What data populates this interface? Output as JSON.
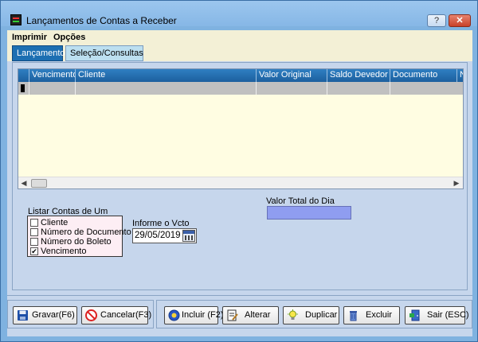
{
  "window": {
    "title": "Lançamentos de Contas a Receber",
    "help_label": "?",
    "close_label": "✕"
  },
  "menu": {
    "items": [
      {
        "label": "Imprimir"
      },
      {
        "label": "Opções"
      }
    ]
  },
  "tabs": [
    {
      "label": "Lançamentos",
      "active": true
    },
    {
      "label": "Seleção/Consultas",
      "active": false
    }
  ],
  "grid": {
    "columns": [
      "Vencimento",
      "Cliente",
      "Valor Original",
      "Saldo Devedor",
      "Documento",
      "Nº"
    ],
    "rows": [
      {
        "vencimento": "",
        "cliente": "",
        "valor_original": "",
        "saldo_devedor": "",
        "documento": ""
      }
    ]
  },
  "scrollbar": {
    "left_arrow": "◀",
    "right_arrow": "▶"
  },
  "total": {
    "label": "Valor Total do Dia",
    "value": ""
  },
  "list_filter": {
    "label": "Listar Contas de Um",
    "options": [
      {
        "label": "Cliente",
        "checked": false
      },
      {
        "label": "Número de Documento",
        "checked": false
      },
      {
        "label": "Número do Boleto",
        "checked": false
      },
      {
        "label": "Vencimento",
        "checked": true
      }
    ]
  },
  "vcto": {
    "label": "Informe o Vcto",
    "value": "29/05/2019"
  },
  "buttons": {
    "gravar": "Gravar(F6)",
    "cancelar": "Cancelar(F3)",
    "incluir": "Incluir (F2)",
    "alterar": "Alterar",
    "duplicar": "Duplicar",
    "excluir": "Excluir",
    "sair": "Sair (ESC)"
  },
  "colors": {
    "active_tab": "#1c6fb2",
    "grid_header": "#2f7fc2",
    "grid_background": "#fffde2",
    "total_box": "#8f9df0"
  }
}
